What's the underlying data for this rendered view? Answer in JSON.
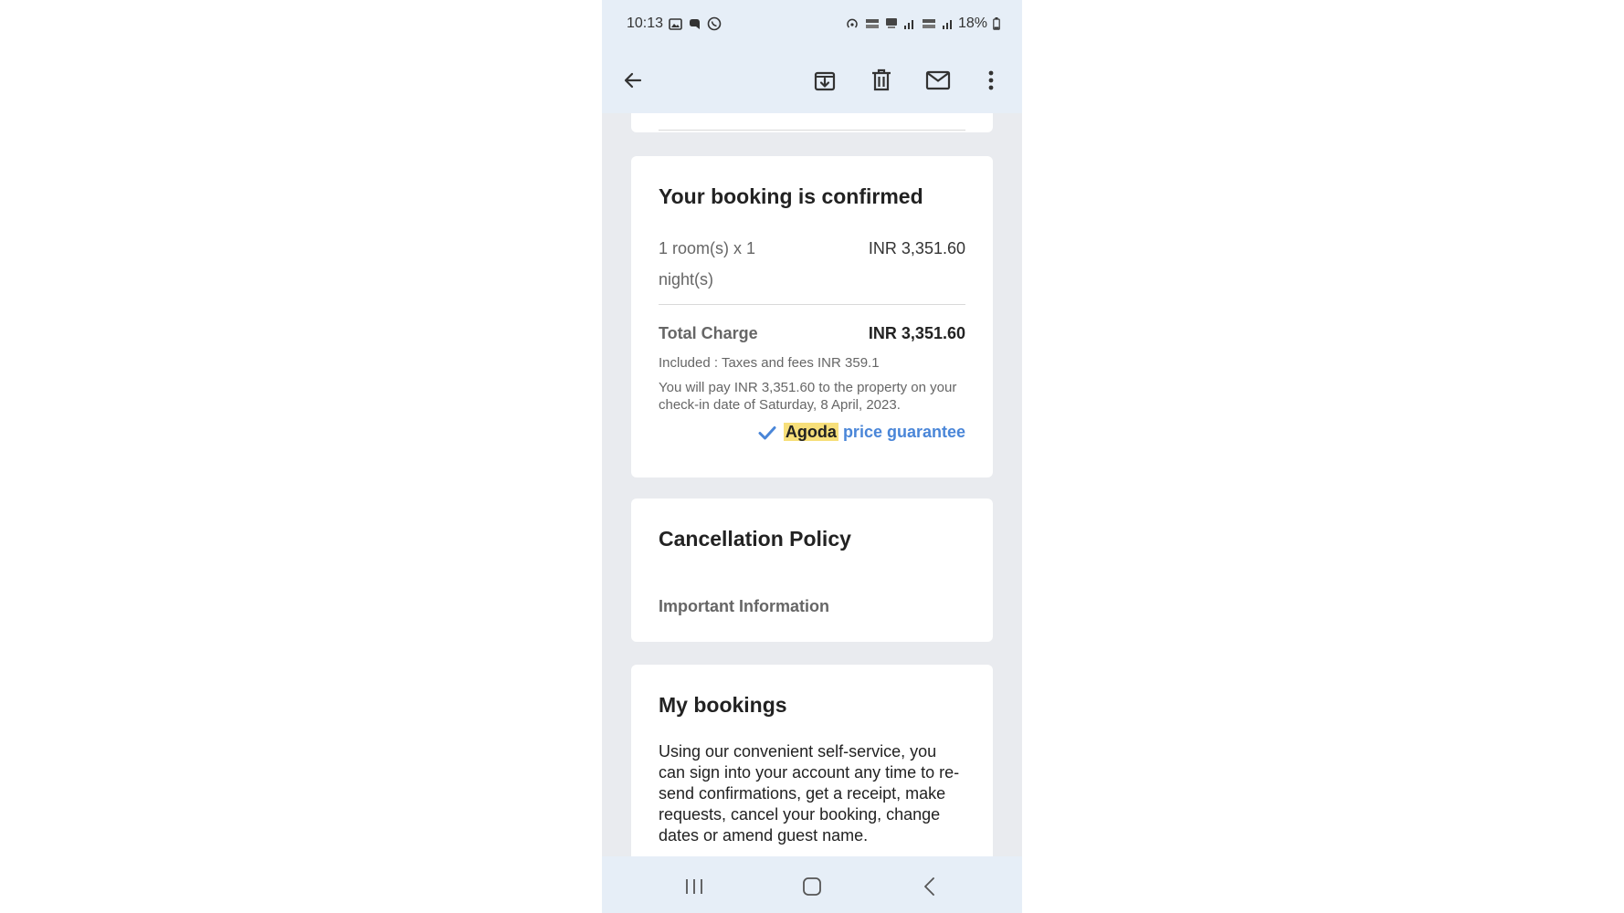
{
  "status_bar": {
    "time": "10:13",
    "battery": "18%"
  },
  "toolbar": {
    "back_icon": "arrow-left-icon",
    "archive_icon": "archive-icon",
    "delete_icon": "trash-icon",
    "mark_unread_icon": "mail-icon",
    "more_icon": "more-vert-icon"
  },
  "booking": {
    "title": "Your booking is confirmed",
    "rooms_label": "1 room(s) x 1 night(s)",
    "rooms_price": "INR 3,351.60",
    "total_label": "Total Charge",
    "total_value": "INR 3,351.60",
    "included": "Included : Taxes and fees INR 359.1",
    "pay_note": "You will pay INR 3,351.60 to the property on your check-in date of Saturday, 8 April, 2023.",
    "guarantee_brand": "Agoda",
    "guarantee_suffix": "price guarantee",
    "accent_color": "#4a86d8",
    "highlight_color": "#f7df7a"
  },
  "cancellation": {
    "title": "Cancellation Policy",
    "important": "Important Information"
  },
  "my_bookings": {
    "title": "My bookings",
    "body": "Using our convenient self-service, you can sign into your account any time to re-send confirmations, get a receipt, make requests, cancel your booking, change dates or amend guest name."
  },
  "nav_bar": {
    "recents_icon": "recents-icon",
    "home_icon": "home-icon",
    "back_icon": "nav-back-icon"
  }
}
